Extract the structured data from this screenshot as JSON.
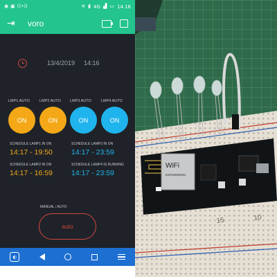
{
  "statusbar": {
    "left_icons": [
      "eye-icon",
      "screen-icon",
      "nfc-icon"
    ],
    "network": "4G",
    "time": "14.16"
  },
  "appbar": {
    "title": "voro",
    "back_icon": "back-arrow-icon",
    "right_icons": [
      "device-icon",
      "square-icon"
    ]
  },
  "rtc": {
    "date": "13/4/2019",
    "time": "14:16"
  },
  "lamps": [
    {
      "label": "LMP1 AUTO",
      "state": "ON",
      "color": "#f4a817"
    },
    {
      "label": "LMP2 AUTO",
      "state": "ON",
      "color": "#f4a817"
    },
    {
      "label": "LMP3 AUTO",
      "state": "ON",
      "color": "#1fb4ee"
    },
    {
      "label": "LMP4 AUTO",
      "state": "ON",
      "color": "#1fb4ee"
    }
  ],
  "schedules": [
    {
      "label": "SCHEDULE LAMP1 IN ON",
      "value": "14:17 - 19:50",
      "color": "#f4a817"
    },
    {
      "label": "SCHEDULE LAMP3 IN ON",
      "value": "14:17 - 23:59",
      "color": "#1fb4ee"
    },
    {
      "label": "SCHEDULE LAMP2 IN ON",
      "value": "14:17 - 16:59",
      "color": "#f4a817"
    },
    {
      "label": "SCHEDULE LAMP4 IS RUNNING",
      "value": "14:17 - 23:59",
      "color": "#1fb4ee"
    }
  ],
  "mode": {
    "label": "MANUAL / AUTO",
    "button": "auto",
    "color": "#d4453f"
  },
  "navbar": {
    "icons": [
      "app-icon",
      "back-icon",
      "home-icon",
      "recent-apps-icon",
      "menu-icon"
    ]
  },
  "photo": {
    "module_text": "WiFi",
    "module_subtext": "ESP8266MOD",
    "board_numbers": [
      "15",
      "10"
    ]
  },
  "colors": {
    "header_green": "#23c48e",
    "panel_dark": "#1f2329",
    "nav_blue": "#1d6fd1"
  }
}
